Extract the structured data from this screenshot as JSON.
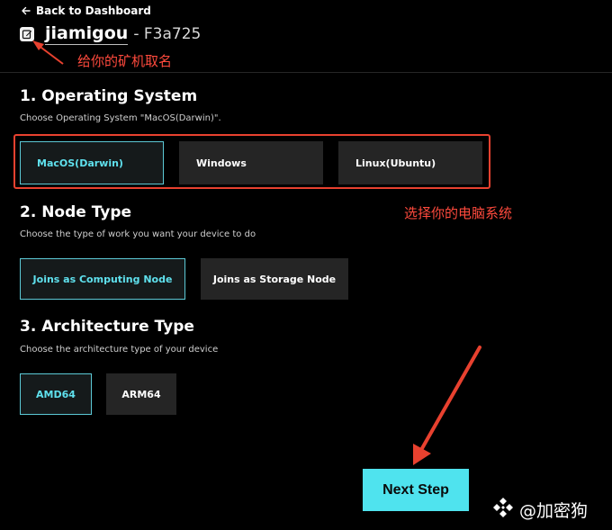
{
  "header": {
    "back_label": "Back to Dashboard",
    "miner_name": "jiamigou",
    "miner_id": "- F3a725"
  },
  "annotations": {
    "name_hint": "给你的矿机取名",
    "os_hint": "选择你的电脑系统",
    "color": "#e8412f"
  },
  "os_section": {
    "title": "1. Operating System",
    "description": "Choose Operating System \"MacOS(Darwin)\".",
    "options": [
      "MacOS(Darwin)",
      "Windows",
      "Linux(Ubuntu)"
    ],
    "selected": "MacOS(Darwin)"
  },
  "node_section": {
    "title": "2. Node Type",
    "description": "Choose the type of work you want your device to do",
    "options": [
      "Joins as Computing Node",
      "Joins as Storage Node"
    ],
    "selected": "Joins as Computing Node"
  },
  "arch_section": {
    "title": "3. Architecture Type",
    "description": "Choose the architecture type of your device",
    "options": [
      "AMD64",
      "ARM64"
    ],
    "selected": "AMD64"
  },
  "actions": {
    "next_label": "Next Step"
  },
  "watermark": {
    "text": "@加密狗",
    "icon": "binance-diamond-icon"
  },
  "colors": {
    "background": "#000000",
    "accent": "#4fe3ee",
    "selected_border": "#5cc9d6",
    "option_bg": "#252525"
  }
}
